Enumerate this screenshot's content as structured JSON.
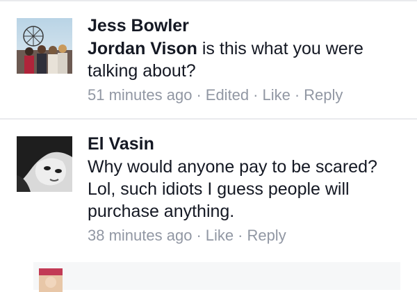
{
  "comments": [
    {
      "author": "Jess Bowler",
      "mention": "Jordan Vison",
      "text": " is this what you were talking about?",
      "meta": {
        "time": "51 minutes ago",
        "sep1": "·",
        "edited": "Edited",
        "sep2": "·",
        "like": "Like",
        "sep3": "·",
        "reply": "Reply"
      }
    },
    {
      "author": "El Vasin",
      "text": "Why would anyone pay to be scared? Lol, such idiots I guess people will purchase anything.",
      "meta": {
        "time": "38 minutes ago",
        "sep1": "·",
        "like": "Like",
        "sep2": "·",
        "reply": "Reply"
      }
    }
  ],
  "colors": {
    "text": "#141823",
    "meta": "#9197a3",
    "divider": "#e9eaed",
    "reply_box": "#f6f7f8"
  }
}
